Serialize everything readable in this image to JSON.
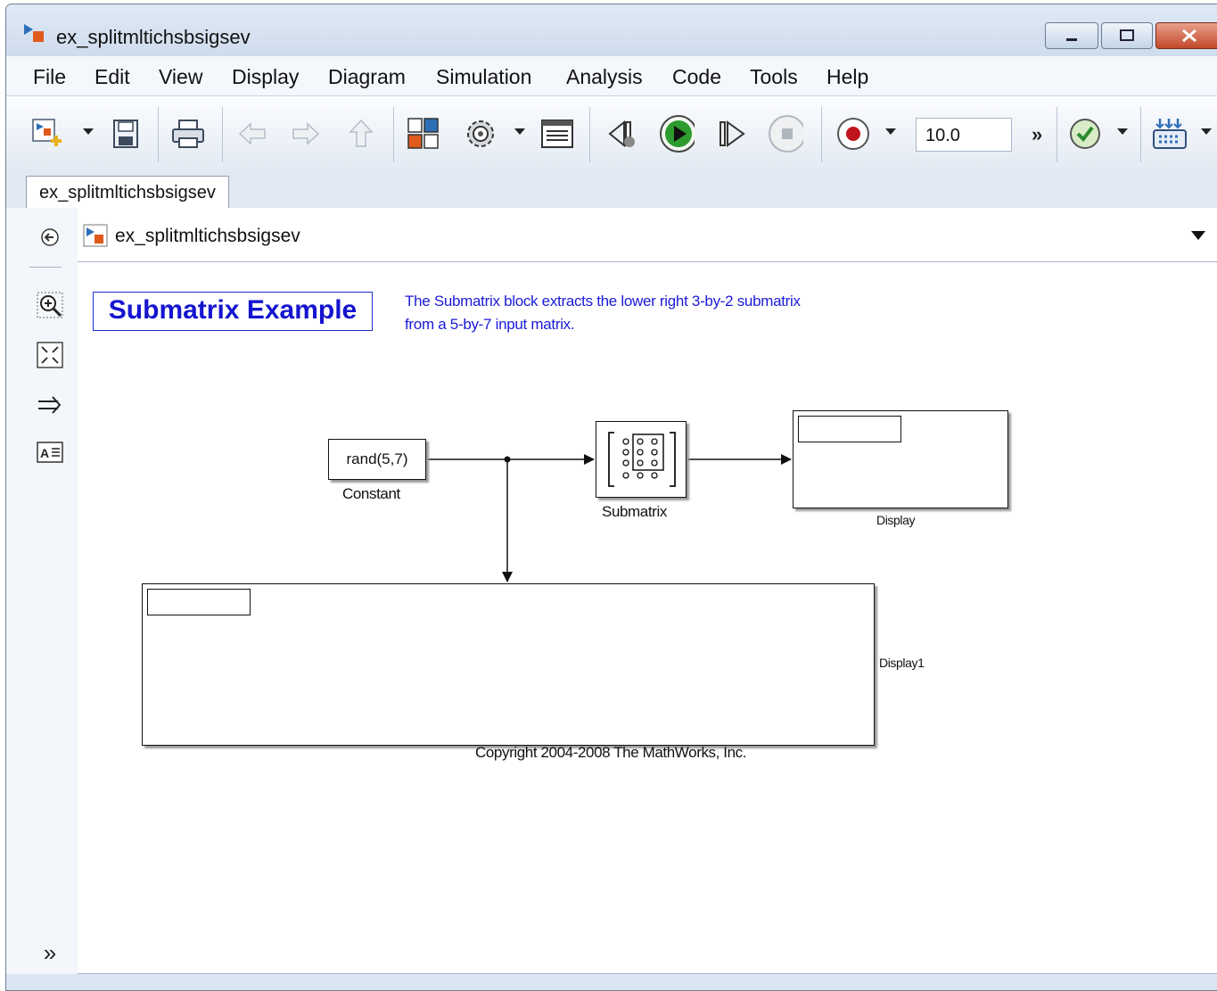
{
  "window": {
    "title": "ex_splitmltichsbsigsev"
  },
  "menu": [
    "File",
    "Edit",
    "View",
    "Display",
    "Diagram",
    "Simulation",
    "Analysis",
    "Code",
    "Tools",
    "Help"
  ],
  "toolbar": {
    "sim_stop_time": "10.0",
    "icons": [
      "new-model-icon",
      "save-icon",
      "print-icon",
      "back-icon",
      "forward-icon",
      "up-icon",
      "library-browser-icon",
      "model-config-icon",
      "model-explorer-icon",
      "step-back-icon",
      "run-icon",
      "step-forward-icon",
      "stop-icon",
      "record-icon",
      "overflow-icon",
      "check-icon",
      "build-icon"
    ]
  },
  "tab": {
    "label": "ex_splitmltichsbsigsev"
  },
  "address": {
    "path": "ex_splitmltichsbsigsev"
  },
  "leftbar": {
    "icons": [
      "navigate-back-icon",
      "zoom-icon",
      "fit-view-icon",
      "arrow-right-icon",
      "annotation-icon",
      "expand-icon"
    ]
  },
  "diagram": {
    "title": "Submatrix Example",
    "description_line1": "The Submatrix block extracts the lower right 3-by-2 submatrix",
    "description_line2": "from a 5-by-7 input matrix.",
    "constant_value": "rand(5,7)",
    "constant_label": "Constant",
    "submatrix_label": "Submatrix",
    "display_label": "Display",
    "display1_label": "Display1",
    "copyright": "Copyright 2004-2008 The MathWorks, Inc."
  },
  "colors": {
    "annotation_blue": "#1414d0",
    "run_green": "#2e9b2e",
    "record_red": "#c0141c"
  }
}
